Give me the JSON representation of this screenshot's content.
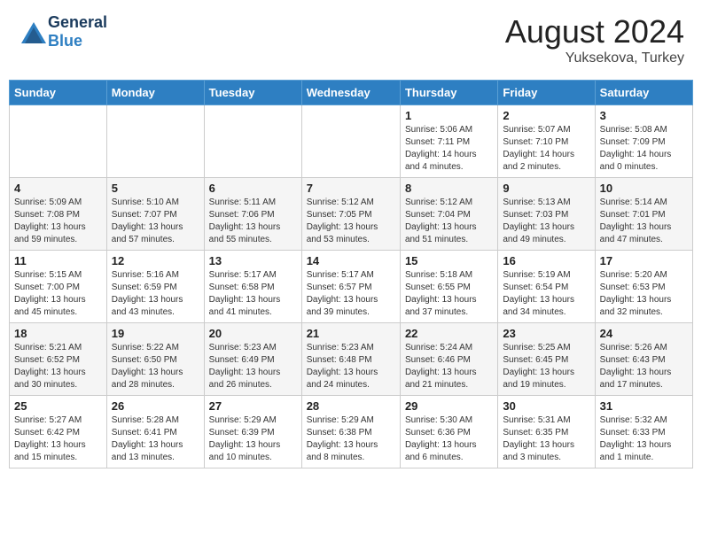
{
  "header": {
    "logo_general": "General",
    "logo_blue": "Blue",
    "month_year": "August 2024",
    "location": "Yuksekova, Turkey"
  },
  "days_of_week": [
    "Sunday",
    "Monday",
    "Tuesday",
    "Wednesday",
    "Thursday",
    "Friday",
    "Saturday"
  ],
  "weeks": [
    [
      {
        "day": "",
        "info": ""
      },
      {
        "day": "",
        "info": ""
      },
      {
        "day": "",
        "info": ""
      },
      {
        "day": "",
        "info": ""
      },
      {
        "day": "1",
        "info": "Sunrise: 5:06 AM\nSunset: 7:11 PM\nDaylight: 14 hours\nand 4 minutes."
      },
      {
        "day": "2",
        "info": "Sunrise: 5:07 AM\nSunset: 7:10 PM\nDaylight: 14 hours\nand 2 minutes."
      },
      {
        "day": "3",
        "info": "Sunrise: 5:08 AM\nSunset: 7:09 PM\nDaylight: 14 hours\nand 0 minutes."
      }
    ],
    [
      {
        "day": "4",
        "info": "Sunrise: 5:09 AM\nSunset: 7:08 PM\nDaylight: 13 hours\nand 59 minutes."
      },
      {
        "day": "5",
        "info": "Sunrise: 5:10 AM\nSunset: 7:07 PM\nDaylight: 13 hours\nand 57 minutes."
      },
      {
        "day": "6",
        "info": "Sunrise: 5:11 AM\nSunset: 7:06 PM\nDaylight: 13 hours\nand 55 minutes."
      },
      {
        "day": "7",
        "info": "Sunrise: 5:12 AM\nSunset: 7:05 PM\nDaylight: 13 hours\nand 53 minutes."
      },
      {
        "day": "8",
        "info": "Sunrise: 5:12 AM\nSunset: 7:04 PM\nDaylight: 13 hours\nand 51 minutes."
      },
      {
        "day": "9",
        "info": "Sunrise: 5:13 AM\nSunset: 7:03 PM\nDaylight: 13 hours\nand 49 minutes."
      },
      {
        "day": "10",
        "info": "Sunrise: 5:14 AM\nSunset: 7:01 PM\nDaylight: 13 hours\nand 47 minutes."
      }
    ],
    [
      {
        "day": "11",
        "info": "Sunrise: 5:15 AM\nSunset: 7:00 PM\nDaylight: 13 hours\nand 45 minutes."
      },
      {
        "day": "12",
        "info": "Sunrise: 5:16 AM\nSunset: 6:59 PM\nDaylight: 13 hours\nand 43 minutes."
      },
      {
        "day": "13",
        "info": "Sunrise: 5:17 AM\nSunset: 6:58 PM\nDaylight: 13 hours\nand 41 minutes."
      },
      {
        "day": "14",
        "info": "Sunrise: 5:17 AM\nSunset: 6:57 PM\nDaylight: 13 hours\nand 39 minutes."
      },
      {
        "day": "15",
        "info": "Sunrise: 5:18 AM\nSunset: 6:55 PM\nDaylight: 13 hours\nand 37 minutes."
      },
      {
        "day": "16",
        "info": "Sunrise: 5:19 AM\nSunset: 6:54 PM\nDaylight: 13 hours\nand 34 minutes."
      },
      {
        "day": "17",
        "info": "Sunrise: 5:20 AM\nSunset: 6:53 PM\nDaylight: 13 hours\nand 32 minutes."
      }
    ],
    [
      {
        "day": "18",
        "info": "Sunrise: 5:21 AM\nSunset: 6:52 PM\nDaylight: 13 hours\nand 30 minutes."
      },
      {
        "day": "19",
        "info": "Sunrise: 5:22 AM\nSunset: 6:50 PM\nDaylight: 13 hours\nand 28 minutes."
      },
      {
        "day": "20",
        "info": "Sunrise: 5:23 AM\nSunset: 6:49 PM\nDaylight: 13 hours\nand 26 minutes."
      },
      {
        "day": "21",
        "info": "Sunrise: 5:23 AM\nSunset: 6:48 PM\nDaylight: 13 hours\nand 24 minutes."
      },
      {
        "day": "22",
        "info": "Sunrise: 5:24 AM\nSunset: 6:46 PM\nDaylight: 13 hours\nand 21 minutes."
      },
      {
        "day": "23",
        "info": "Sunrise: 5:25 AM\nSunset: 6:45 PM\nDaylight: 13 hours\nand 19 minutes."
      },
      {
        "day": "24",
        "info": "Sunrise: 5:26 AM\nSunset: 6:43 PM\nDaylight: 13 hours\nand 17 minutes."
      }
    ],
    [
      {
        "day": "25",
        "info": "Sunrise: 5:27 AM\nSunset: 6:42 PM\nDaylight: 13 hours\nand 15 minutes."
      },
      {
        "day": "26",
        "info": "Sunrise: 5:28 AM\nSunset: 6:41 PM\nDaylight: 13 hours\nand 13 minutes."
      },
      {
        "day": "27",
        "info": "Sunrise: 5:29 AM\nSunset: 6:39 PM\nDaylight: 13 hours\nand 10 minutes."
      },
      {
        "day": "28",
        "info": "Sunrise: 5:29 AM\nSunset: 6:38 PM\nDaylight: 13 hours\nand 8 minutes."
      },
      {
        "day": "29",
        "info": "Sunrise: 5:30 AM\nSunset: 6:36 PM\nDaylight: 13 hours\nand 6 minutes."
      },
      {
        "day": "30",
        "info": "Sunrise: 5:31 AM\nSunset: 6:35 PM\nDaylight: 13 hours\nand 3 minutes."
      },
      {
        "day": "31",
        "info": "Sunrise: 5:32 AM\nSunset: 6:33 PM\nDaylight: 13 hours\nand 1 minute."
      }
    ]
  ]
}
